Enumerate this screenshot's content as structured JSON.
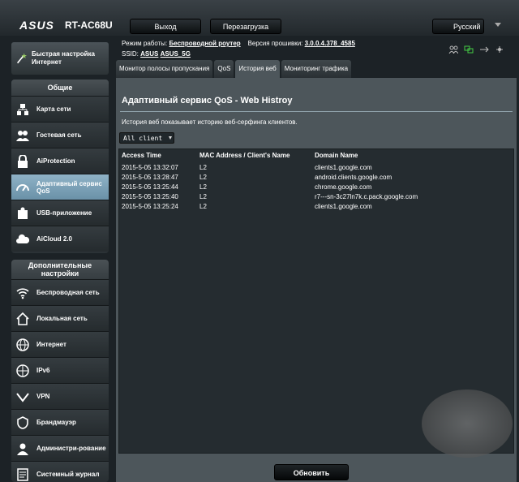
{
  "header": {
    "logo": "ASUS",
    "model": "RT-AC68U",
    "logout_label": "Выход",
    "reboot_label": "Перезагрузка",
    "language": "Русский"
  },
  "info": {
    "mode_label": "Режим работы:",
    "mode_value": "Беспроводной роутер",
    "firmware_label": "Версия прошивки:",
    "firmware_value": "3.0.0.4.378_4585",
    "ssid_label": "SSID:",
    "ssid_1": "ASUS",
    "ssid_2": "ASUS_5G"
  },
  "sidebar": {
    "quick_setup": "Быстрая настройка Интернет",
    "general_title": "Общие",
    "general_items": [
      {
        "label": "Карта сети"
      },
      {
        "label": "Гостевая сеть"
      },
      {
        "label": "AiProtection"
      },
      {
        "label": "Адаптивный сервис QoS"
      },
      {
        "label": "USB-приложение"
      },
      {
        "label": "AiCloud 2.0"
      }
    ],
    "advanced_title": "Дополнительные настройки",
    "advanced_items": [
      {
        "label": "Беспроводная сеть"
      },
      {
        "label": "Локальная сеть"
      },
      {
        "label": "Интернет"
      },
      {
        "label": "IPv6"
      },
      {
        "label": "VPN"
      },
      {
        "label": "Брандмауэр"
      },
      {
        "label": "Администри-рование"
      },
      {
        "label": "Системный журнал"
      }
    ]
  },
  "tabs": [
    {
      "label": "Монитор полосы пропускания"
    },
    {
      "label": "QoS"
    },
    {
      "label": "История веб"
    },
    {
      "label": "Мониторинг трафика"
    }
  ],
  "main": {
    "title": "Адаптивный сервис QoS - Web Histroy",
    "description": "История веб показывает историю веб-серфинга клиентов.",
    "client_select": "All client",
    "columns": [
      "Access Time",
      "MAC Address / Client's Name",
      "Domain Name"
    ],
    "rows": [
      {
        "time": "2015-5-05  13:32:07",
        "mac": "L2",
        "domain": "clients1.google.com"
      },
      {
        "time": "2015-5-05  13:28:47",
        "mac": "L2",
        "domain": "android.clients.google.com"
      },
      {
        "time": "2015-5-05  13:25:44",
        "mac": "L2",
        "domain": "chrome.google.com"
      },
      {
        "time": "2015-5-05  13:25:40",
        "mac": "L2",
        "domain": "r7---sn-3c27ln7k.c.pack.google.com"
      },
      {
        "time": "2015-5-05  13:25:24",
        "mac": "L2",
        "domain": "clients1.google.com"
      }
    ],
    "refresh_label": "Обновить"
  },
  "colors": {
    "active_nav": "#7fa3b8",
    "panel": "#4d565b",
    "background": "#1c2226"
  }
}
